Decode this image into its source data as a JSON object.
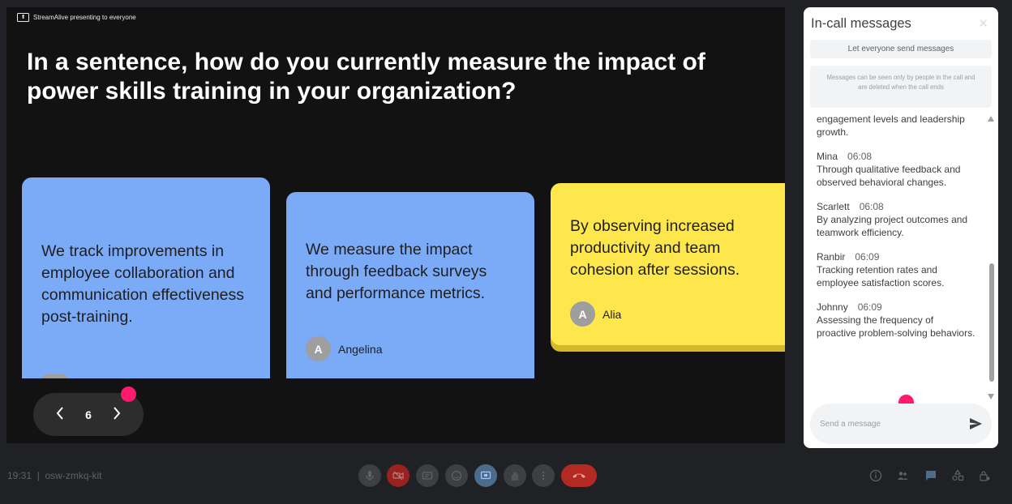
{
  "stage": {
    "presenting_label": "StreamAlive presenting to everyone",
    "question": "In a sentence, how do you currently measure the impact of power skills training in your organization?",
    "cards": [
      {
        "text": "We track improvements in employee collaboration and communication effectiveness post-training.",
        "color": "#7baaf7"
      },
      {
        "text": "We measure the impact through feedback surveys and performance metrics.",
        "author_initial": "A",
        "author": "Angelina",
        "color": "#7baaf7"
      },
      {
        "text": "By observing increased productivity and team cohesion after sessions.",
        "author_initial": "A",
        "author": "Alia",
        "color": "#fde74c"
      }
    ],
    "pager": {
      "current": "6"
    }
  },
  "chat": {
    "title": "In-call messages",
    "toggle_label": "Let everyone send messages",
    "notice": "Messages can be seen only by people in the call and are deleted when the call ends",
    "partial_message": "engagement levels and leadership growth.",
    "messages": [
      {
        "sender": "Mina",
        "time": "06:08",
        "text": "Through qualitative feedback and observed behavioral changes."
      },
      {
        "sender": "Scarlett",
        "time": "06:08",
        "text": "By analyzing project outcomes and teamwork efficiency."
      },
      {
        "sender": "Ranbir",
        "time": "06:09",
        "text": "Tracking retention rates and employee satisfaction scores."
      },
      {
        "sender": "Johnny",
        "time": "06:09",
        "text": "Assessing the frequency of proactive problem-solving behaviors."
      }
    ],
    "compose_placeholder": "Send a message"
  },
  "bottom_bar": {
    "meeting_info": "19:31  |  osw-zmkq-kit"
  },
  "colors": {
    "accent_pink": "#ff1a6e",
    "chat_accent": "#1a73e8",
    "end_call": "#b22a22"
  }
}
